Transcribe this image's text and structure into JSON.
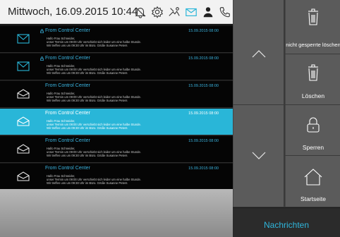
{
  "header": {
    "datetime": "Mittwoch, 16.09.2015 10:44",
    "icons": [
      "bell-off-icon",
      "settings-icon",
      "intercom-icon",
      "message-icon",
      "user-icon",
      "phone-icon"
    ]
  },
  "messages": [
    {
      "from": "From Control Center",
      "timestamp": "15.09.2015 08:00",
      "line1": "Hallo Frau Schneider,",
      "line2": "unser Termin um 09:00 Uhr verschiebt sich leider um eine halbe Stunde.",
      "line3": "Wir treffen uns um 09:30 Uhr im Büro. Grüße Susanne Peters",
      "locked": true,
      "read": false,
      "selected": false
    },
    {
      "from": "From Control Center",
      "timestamp": "15.09.2015 08:00",
      "line1": "Hallo Frau Schneider,",
      "line2": "unser Termin um 09:00 Uhr verschiebt sich leider um eine halbe Stunde.",
      "line3": "Wir treffen uns um 09:30 Uhr im Büro. Grüße Susanne Peters",
      "locked": true,
      "read": false,
      "selected": false
    },
    {
      "from": "From Control Center",
      "timestamp": "15.09.2015 08:00",
      "line1": "Hallo Frau Schneider,",
      "line2": "unser Termin um 09:00 Uhr verschiebt sich leider um eine halbe Stunde.",
      "line3": "Wir treffen uns um 09:30 Uhr im Büro. Grüße Susanne Peters",
      "locked": false,
      "read": true,
      "selected": false
    },
    {
      "from": "From Control Center",
      "timestamp": "15.09.2015 08:00",
      "line1": "Hallo Frau Schneider,",
      "line2": "unser Termin um 09:00 Uhr verschiebt sich leider um eine halbe Stunde.",
      "line3": "Wir treffen uns um 09:30 Uhr im Büro. Grüße Susanne Peters",
      "locked": false,
      "read": true,
      "selected": true
    },
    {
      "from": "From Control Center",
      "timestamp": "15.09.2015 08:00",
      "line1": "Hallo Frau Schneider,",
      "line2": "unser Termin um 09:00 Uhr verschiebt sich leider um eine halbe Stunde.",
      "line3": "Wir treffen uns um 09:30 Uhr im Büro. Grüße Susanne Peters",
      "locked": false,
      "read": true,
      "selected": false
    },
    {
      "from": "From Control Center",
      "timestamp": "15.09.2015 08:00",
      "line1": "Hallo Frau Schneider,",
      "line2": "unser Termin um 09:00 Uhr verschiebt sich leider um eine halbe Stunde.",
      "line3": "Wir treffen uns um 09:30 Uhr im Büro. Grüße Susanne Peters",
      "locked": false,
      "read": true,
      "selected": false
    }
  ],
  "actions": {
    "delete_unlocked": "nicht gesperrte löschen",
    "delete": "Löschen",
    "lock": "Sperren",
    "home": "Startseite"
  },
  "tab": {
    "label": "Nachrichten"
  },
  "colors": {
    "accent": "#29b6d8",
    "list_bg": "#050505",
    "panel_bg": "#5b5b5b"
  }
}
